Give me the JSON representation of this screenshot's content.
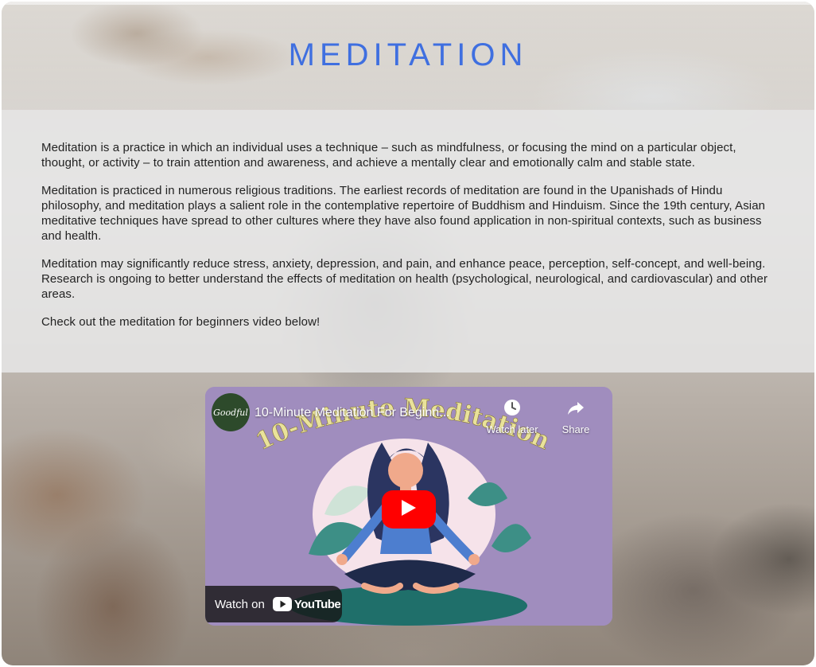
{
  "page": {
    "title": "MEDITATION"
  },
  "content": {
    "paragraphs": [
      "Meditation is a practice in which an individual uses a technique – such as mindfulness, or focusing the mind on a particular object, thought, or activity – to train attention and awareness, and achieve a mentally clear and emotionally calm and stable state.",
      "Meditation is practiced in numerous religious traditions. The earliest records of meditation are found in the Upanishads of Hindu philosophy, and meditation plays a salient role in the contemplative repertoire of Buddhism and Hinduism. Since the 19th century, Asian meditative techniques have spread to other cultures where they have also found application in non-spiritual contexts, such as business and health.",
      "Meditation may significantly reduce stress, anxiety, depression, and pain, and enhance peace, perception, self-concept, and well-being. Research is ongoing to better understand the effects of meditation on health (psychological, neurological, and cardiovascular) and other areas.",
      "Check out the meditation for beginners video below!"
    ]
  },
  "video": {
    "channel_name": "Goodful",
    "title": "10-Minute Meditation For Beginn...",
    "thumbnail_text": "10-Minute Meditation",
    "watch_later_label": "Watch later",
    "share_label": "Share",
    "watch_on_label": "Watch on",
    "youtube_label": "YouTube",
    "icons": {
      "watch_later": "clock-icon",
      "share": "share-icon",
      "play": "play-icon"
    },
    "colors": {
      "background": "#a08dbe",
      "play_button": "#ff0000",
      "thumbnail_text": "#e9e29a"
    }
  },
  "theme": {
    "title_color": "#3f6fe0",
    "panel_color": "#e6e6e6"
  }
}
